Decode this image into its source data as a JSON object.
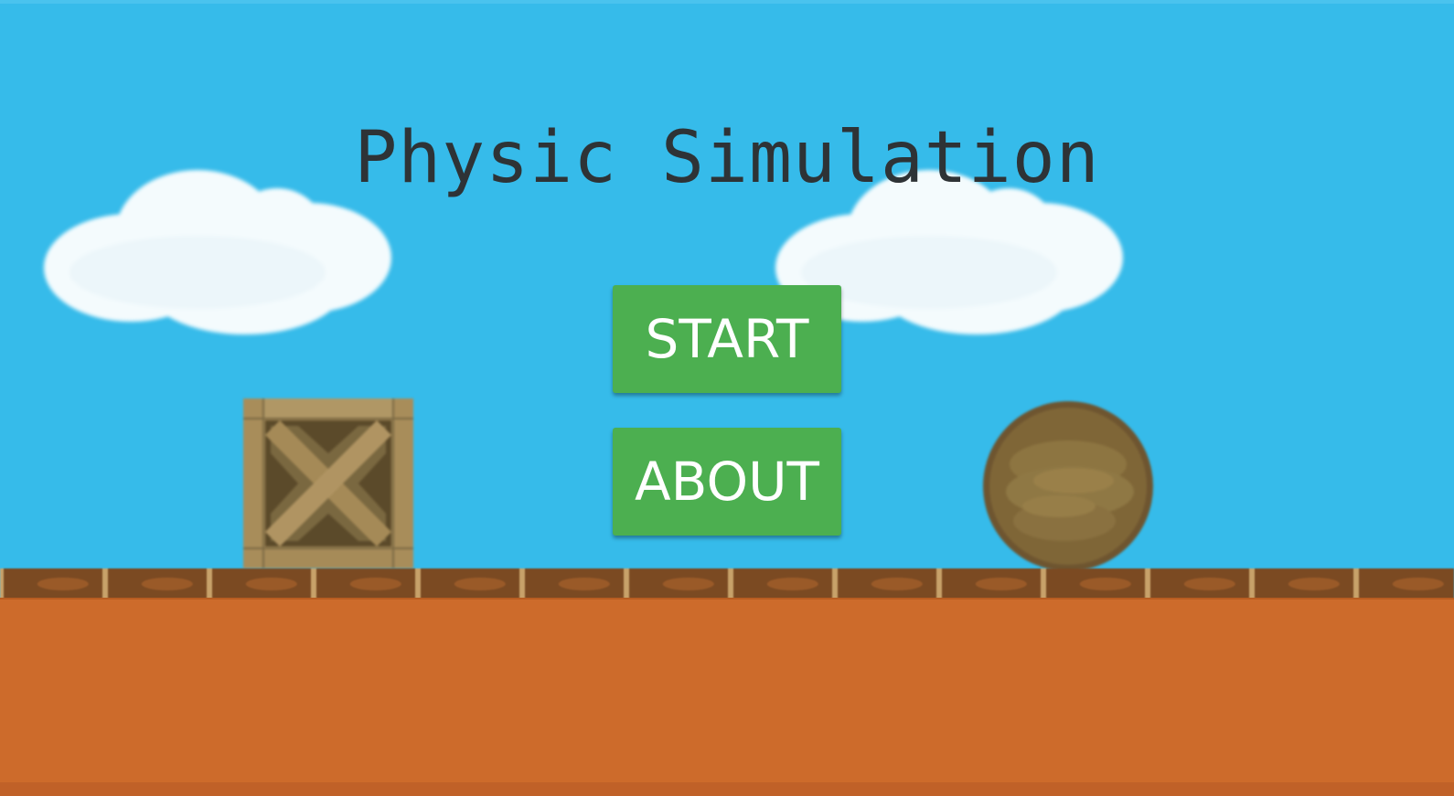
{
  "title": "Physic Simulation",
  "menu": {
    "start_label": "START",
    "about_label": "ABOUT"
  },
  "colors": {
    "sky": "#36bbea",
    "button": "#4caf50",
    "ground": "#cd6b2b",
    "planks": "#7a4a22",
    "title_text": "#2e3336"
  },
  "sprites": {
    "crate": "wooden-crate-icon",
    "ball": "wooden-ball-icon",
    "cloud": "cloud-icon"
  }
}
